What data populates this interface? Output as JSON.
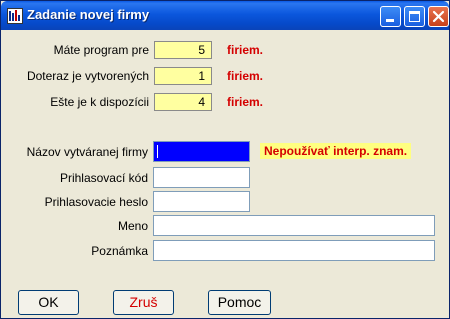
{
  "window": {
    "title": "Zadanie novej firmy"
  },
  "stats": [
    {
      "label": "Máte program pre",
      "value": "5",
      "unit": "firiem."
    },
    {
      "label": "Doteraz je vytvorených",
      "value": "1",
      "unit": "firiem."
    },
    {
      "label": "Ešte je k dispozícii",
      "value": "4",
      "unit": "firiem."
    }
  ],
  "form": {
    "company_name_label": "Názov vytváranej firmy",
    "company_name_value": "",
    "warning": "Nepoužívať interp. znam.",
    "login_code_label": "Prihlasovací kód",
    "login_code_value": "",
    "login_password_label": "Prihlasovacie heslo",
    "login_password_value": "",
    "name_label": "Meno",
    "name_value": "",
    "note_label": "Poznámka",
    "note_value": ""
  },
  "buttons": {
    "ok": "OK",
    "cancel": "Zruš",
    "help": "Pomoc"
  },
  "colors": {
    "titlebar": "#0b57dd",
    "field_highlight": "#ffffa0",
    "warning_text": "#d40000",
    "active_field": "#0000ff"
  }
}
